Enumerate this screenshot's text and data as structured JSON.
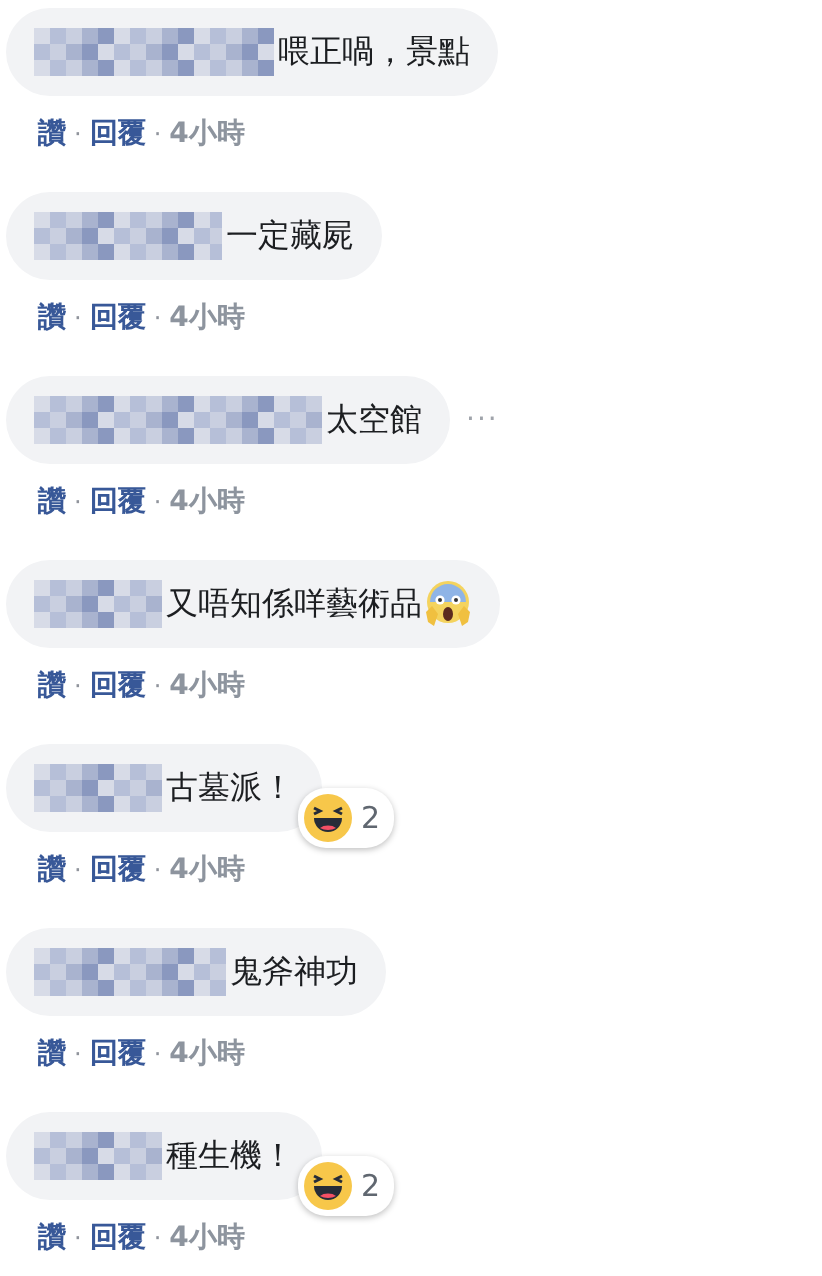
{
  "comments": [
    {
      "text": "喂正喎，景點",
      "actions": {
        "like": "讚",
        "separator_1": "·",
        "reply": "回覆",
        "separator_2": "·",
        "time": "4小時"
      }
    },
    {
      "text": "一定藏屍",
      "actions": {
        "like": "讚",
        "separator_1": "·",
        "reply": "回覆",
        "separator_2": "·",
        "time": "4小時"
      }
    },
    {
      "text": "太空館",
      "more": "···",
      "actions": {
        "like": "讚",
        "separator_1": "·",
        "reply": "回覆",
        "separator_2": "·",
        "time": "4小時"
      }
    },
    {
      "text": "又唔知係咩藝術品",
      "emoji": {
        "kind": "scream"
      },
      "actions": {
        "like": "讚",
        "separator_1": "·",
        "reply": "回覆",
        "separator_2": "·",
        "time": "4小時"
      }
    },
    {
      "text": "古墓派！",
      "reaction": {
        "kind": "haha",
        "count": "2"
      },
      "actions": {
        "like": "讚",
        "separator_1": "·",
        "reply": "回覆",
        "separator_2": "·",
        "time": "4小時"
      }
    },
    {
      "text": "鬼斧神功",
      "actions": {
        "like": "讚",
        "separator_1": "·",
        "reply": "回覆",
        "separator_2": "·",
        "time": "4小時"
      }
    },
    {
      "text": "種生機！",
      "reaction": {
        "kind": "haha",
        "count": "2"
      },
      "actions": {
        "like": "讚",
        "separator_1": "·",
        "reply": "回覆",
        "separator_2": "·",
        "time": "4小時"
      }
    }
  ]
}
